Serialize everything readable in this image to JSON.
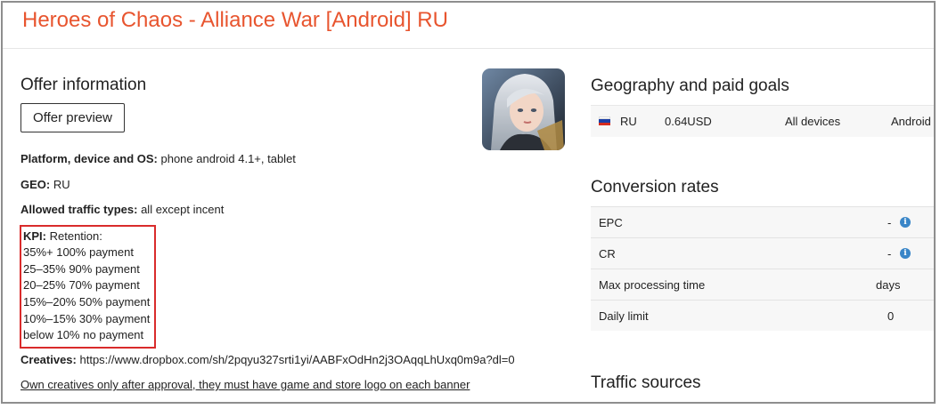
{
  "app_title": "Heroes of Chaos - Alliance War [Android] RU",
  "offer": {
    "title": "Offer information",
    "preview_label": "Offer preview",
    "platform_label": "Platform, device and OS:",
    "platform_value": " phone android 4.1+, tablet",
    "geo_label": "GEO:",
    "geo_value": " RU",
    "traffic_label": "Allowed traffic types:",
    "traffic_value": " all except incent",
    "kpi_label": "KPI:",
    "kpi_intro": " Retention:",
    "kpi_lines": [
      "35%+ 100% payment",
      "25–35% 90% payment",
      "20–25% 70% payment",
      "15%–20% 50% payment",
      "10%–15% 30% payment",
      "below 10% no payment"
    ],
    "creatives_label": "Creatives:",
    "creatives_value": " https://www.dropbox.com/sh/2pqyu327srti1yi/AABFxOdHn2j3OAqqLhUxq0m9a?dl=0",
    "note": "Own creatives only after approval, they must have game and store logo on each banner"
  },
  "geography": {
    "title": "Geography and paid goals",
    "row": {
      "flag_icon": "russia-flag-icon",
      "country": "RU",
      "payout": "0.64USD",
      "devices": "All devices",
      "os": "Android"
    }
  },
  "conversion": {
    "title": "Conversion rates",
    "rows": [
      {
        "label": "EPC",
        "value": "-",
        "info": true
      },
      {
        "label": "CR",
        "value": "-",
        "info": true
      },
      {
        "label": "Max processing time",
        "value": "days",
        "info": false
      },
      {
        "label": "Daily limit",
        "value": "0",
        "info": false
      }
    ]
  },
  "traffic_sources_title": "Traffic sources",
  "colors": {
    "title_accent": "#e8552f",
    "kpi_border": "#d92b2b",
    "info_icon": "#3a86c8"
  }
}
